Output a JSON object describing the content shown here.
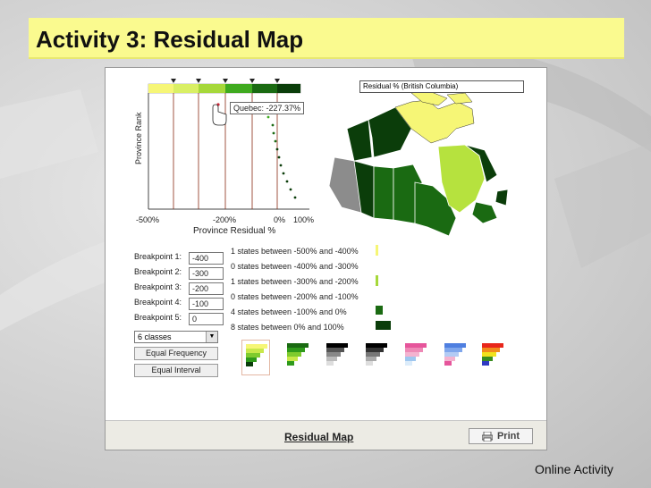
{
  "slide": {
    "title": "Activity 3: Residual Map",
    "footer_label": "Online Activity"
  },
  "plot": {
    "y_axis_label": "Province Rank",
    "x_axis_label": "Province Residual %",
    "tick_labels": [
      "-500%",
      "-200%",
      "0%",
      "100%"
    ],
    "tooltip": "Quebec: -227.37%",
    "class_colors": [
      "#f6f676",
      "#b6e23e",
      "#3faa1f",
      "#1a6a12",
      "#0b3d0a"
    ]
  },
  "controls": {
    "breakpoints": [
      {
        "label": "Breakpoint 1:",
        "value": "-400"
      },
      {
        "label": "Breakpoint 2:",
        "value": "-300"
      },
      {
        "label": "Breakpoint 3:",
        "value": "-200"
      },
      {
        "label": "Breakpoint 4:",
        "value": "-100"
      },
      {
        "label": "Breakpoint 5:",
        "value": "0"
      }
    ],
    "classes_select": "6 classes",
    "equal_frequency_button": "Equal Frequency",
    "equal_interval_button": "Equal Interval"
  },
  "legend": {
    "rows": [
      {
        "text": "1 states between -500% and -400%",
        "color": "#f6f676"
      },
      {
        "text": "0 states between -400% and -300%",
        "color": "#d9ef64"
      },
      {
        "text": "1 states between -300% and -200%",
        "color": "#a6d83a"
      },
      {
        "text": "0 states between -200% and -100%",
        "color": "#3faa1f"
      },
      {
        "text": "4 states between -100% and 0%",
        "color": "#1a6a12"
      },
      {
        "text": "8 states between 0% and 100%",
        "color": "#0b3d0a"
      }
    ]
  },
  "map": {
    "title": "Residual % (British Columbia)"
  },
  "palettes": [
    {
      "name": "yellow-green",
      "colors": [
        "#f6f676",
        "#c8e84a",
        "#7fcb2e",
        "#2f9a1b",
        "#0b3d0a"
      ]
    },
    {
      "name": "green",
      "colors": [
        "#1a6a12",
        "#2f9a1b",
        "#7fcb2e",
        "#c8e84a",
        "#ffffff"
      ]
    },
    {
      "name": "gray",
      "colors": [
        "#000000",
        "#555555",
        "#888888",
        "#bbbbbb",
        "#eeeeee"
      ]
    },
    {
      "name": "black-gray",
      "colors": [
        "#000000",
        "#333333",
        "#777777",
        "#aaaaaa",
        "#dddddd"
      ]
    },
    {
      "name": "pink",
      "colors": [
        "#e6559b",
        "#ee89b6",
        "#f4b3d0",
        "#9fc7ef",
        "#dcecfa"
      ]
    },
    {
      "name": "blue-pink",
      "colors": [
        "#4f7fe0",
        "#7fa6ec",
        "#b3cbf4",
        "#f4b3d0",
        "#e6559b"
      ]
    },
    {
      "name": "rainbow",
      "colors": [
        "#e8261b",
        "#f28b1c",
        "#f2e21c",
        "#3a8d1f",
        "#2f3ac2"
      ]
    }
  ],
  "app_footer": {
    "title": "Residual Map",
    "print_label": "Print"
  }
}
